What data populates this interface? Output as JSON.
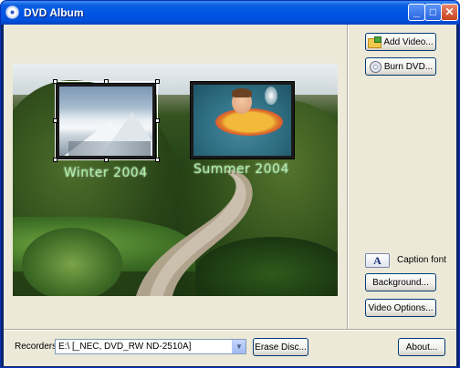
{
  "window": {
    "title": "DVD Album",
    "minimize_glyph": "_",
    "maximize_glyph": "□",
    "close_glyph": "✕"
  },
  "right_panel": {
    "add_video_label": "Add Video...",
    "burn_dvd_label": "Burn DVD...",
    "caption_font_glyph": "A",
    "caption_font_label": "Caption font",
    "background_label": "Background...",
    "video_options_label": "Video Options..."
  },
  "preview": {
    "clips": [
      {
        "caption": "Winter 2004",
        "selected": true
      },
      {
        "caption": "Summer 2004",
        "selected": false
      }
    ],
    "caption_color": "#a8f0a0"
  },
  "bottom_bar": {
    "recorders_label": "Recorders:",
    "recorder_selected": "E:\\  [_NEC, DVD_RW ND-2510A]",
    "erase_disc_label": "Erase Disc...",
    "about_label": "About..."
  },
  "colors": {
    "titlebar": "#0055e5",
    "client_bg": "#ece9d8",
    "button_border": "#003c74"
  }
}
